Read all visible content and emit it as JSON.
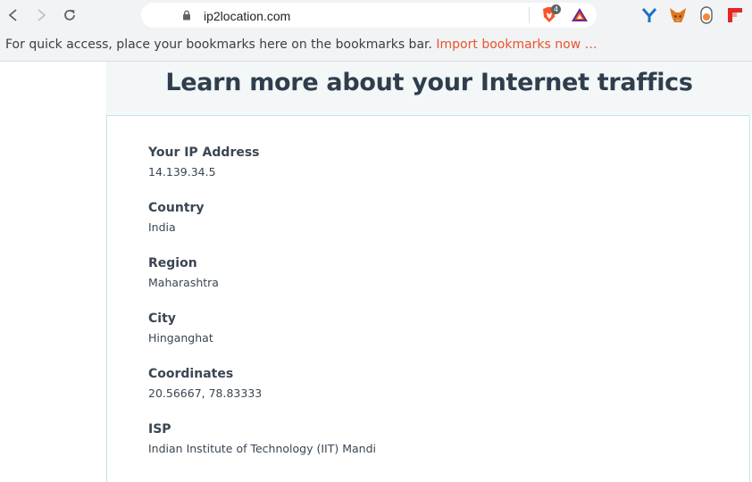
{
  "browser": {
    "url": "ip2location.com",
    "brave_shield_count": "4",
    "bookmarks_bar_message": "For quick access, place your bookmarks here on the bookmarks bar.",
    "bookmarks_import_link": "Import bookmarks now …",
    "extensions": [
      "Y",
      "metamask-fox-icon",
      "toggle-icon",
      "flipboard-icon"
    ]
  },
  "page": {
    "title": "Learn more about your Internet traffics",
    "fields": [
      {
        "label": "Your IP Address",
        "value": "14.139.34.5"
      },
      {
        "label": "Country",
        "value": "India"
      },
      {
        "label": "Region",
        "value": "Maharashtra"
      },
      {
        "label": "City",
        "value": "Hinganghat"
      },
      {
        "label": "Coordinates",
        "value": "20.56667, 78.83333"
      },
      {
        "label": "ISP",
        "value": "Indian Institute of Technology (IIT) Mandi"
      }
    ]
  },
  "colors": {
    "accent_link": "#e8542e",
    "title_text": "#2f3e4c",
    "card_border": "#bfe6ea",
    "header_bg": "#f3f7f8"
  }
}
